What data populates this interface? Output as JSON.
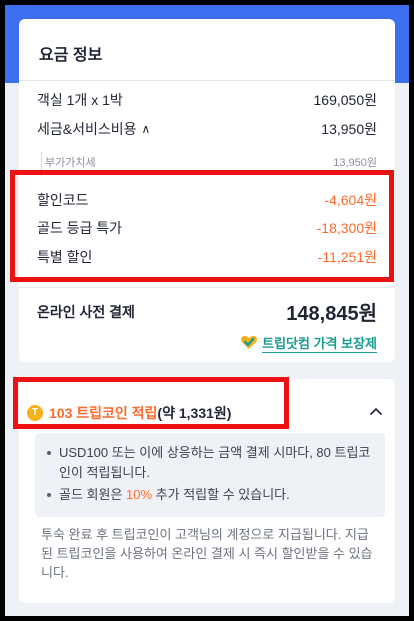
{
  "price_info": {
    "title": "요금 정보",
    "room": {
      "label": "객실 1개 x 1박",
      "value": "169,050원"
    },
    "tax": {
      "label": "세금&서비스비용",
      "value": "13,950원"
    },
    "vat": {
      "label": "부가가치세",
      "value": "13,950원"
    },
    "discounts": [
      {
        "label": "할인코드",
        "value": "-4,604원"
      },
      {
        "label": "골드 등급 특가",
        "value": "-18,300원"
      },
      {
        "label": "특별 할인",
        "value": "-11,251원"
      }
    ],
    "total": {
      "label": "온라인 사전 결제",
      "value": "148,845원"
    },
    "guarantee_label": "트립닷컴 가격 보장제"
  },
  "trip_coins": {
    "amount": "103 트립코인 적립",
    "equivalent": "(약 1,331원)",
    "bullets": {
      "line1": "USD100 또는 이에 상응하는 금액 결제 시마다, 80 트립코인이 적립됩니다.",
      "line2_pre": "골드 회원은 ",
      "line2_pct": "10%",
      "line2_post": " 추가 적립할 수 있습니다."
    },
    "note": "투숙 완료 후 트립코인이 고객님의 계정으로 지급됩니다. 지급된 트립코인을 사용하여 온라인 결제 시 즉시 할인받을 수 있습니다."
  },
  "colors": {
    "accent_blue": "#3d6ff0",
    "discount_orange": "#ff6a2b",
    "guarantee_teal": "#1a9c91",
    "highlight_red": "#ee1111"
  },
  "icons": [
    "chevron-up-icon",
    "heart-check-icon",
    "coin-icon"
  ]
}
